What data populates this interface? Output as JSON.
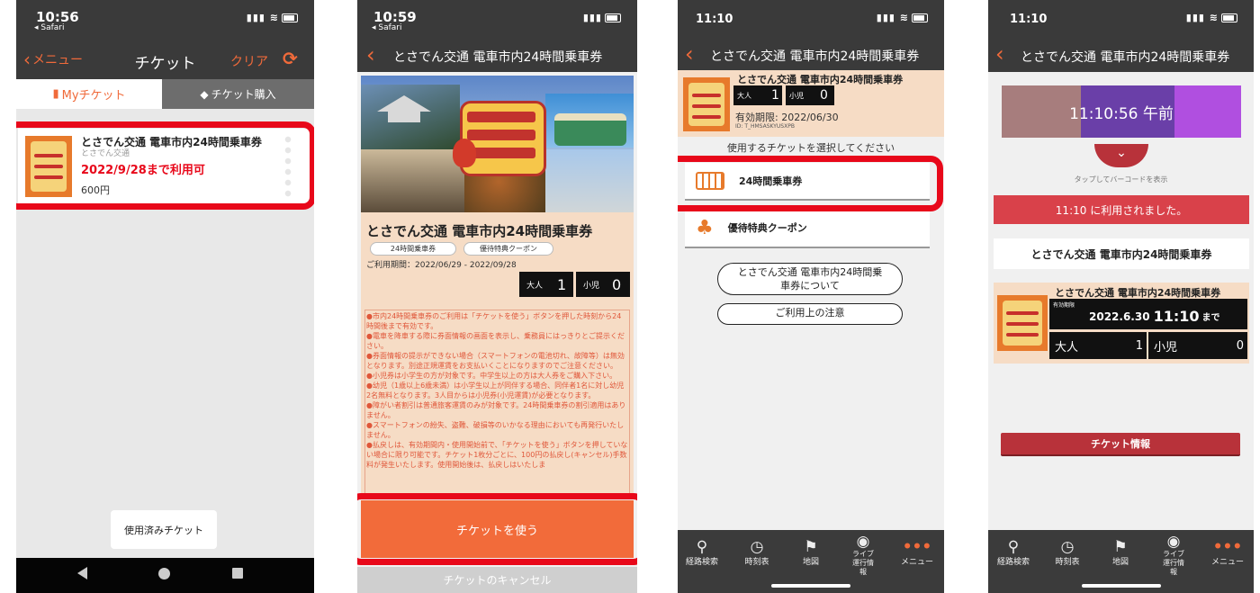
{
  "phone1": {
    "status_time": "10:56",
    "status_app": "◂ Safari",
    "nav": {
      "back_label": "メニュー",
      "title": "チケット",
      "clear_label": "クリア"
    },
    "tabs": {
      "my_tickets": "Myチケット",
      "buy": "チケット購入"
    },
    "ticket": {
      "name": "とさでん交通 電車市内24時間乗車券",
      "issuer": "とさでん交通",
      "valid_until": "2022/9/28まで利用可",
      "price": "600円"
    },
    "used_button": "使用済みチケット"
  },
  "phone2": {
    "status_time": "10:59",
    "status_app": "◂ Safari",
    "nav_title": "とさでん交通 電車市内24時間乗車券",
    "ticket_title": "とさでん交通 電車市内24時間乗車券",
    "tags": [
      "24時間乗車券",
      "優待特典クーポン"
    ],
    "period": "ご利用期間：2022/06/29 - 2022/09/28",
    "adult_label": "大人",
    "adult_count": "1",
    "child_label": "小児",
    "child_count": "0",
    "notes": [
      "●市内24時間乗車券のご利用は「チケットを使う」ボタンを押した時刻から24時間後まで有効です。",
      "●電車を降車する際に券面情報の画面を表示し、乗務員にはっきりとご提示ください。",
      "●券面情報の提示ができない場合（スマートフォンの電池切れ、故障等）は無効となります。別途正規運賃をお支払いくことになりますのでご注意ください。",
      "●小児券は小学生の方が対象です。中学生以上の方は大人券をご購入下さい。",
      "●幼児（1歳以上6歳未満）は小学生以上が同伴する場合、同伴者1名に対し幼児2名無料となります。3人目からは小児券(小児運賃)が必要となります。",
      "●障がい者割引は普通旅客運賃のみが対象です。24時間乗車券の割引適用はありません。",
      "●スマートフォンの紛失、盗難、破損等のいかなる理由においても再発行いたしません。",
      "●払戻しは、有効期間内・使用開始前で、「チケットを使う」ボタンを押していない場合に限り可能です。チケット1枚分ごとに、100円の払戻し(キャンセル)手数料が発生いたします。使用開始後は、払戻しはいたしま"
    ],
    "use_button": "チケットを使う",
    "cancel_button": "チケットのキャンセル"
  },
  "phone3": {
    "status_time": "11:10",
    "nav_title": "とさでん交通 電車市内24時間乗車券",
    "ticket_name": "とさでん交通 電車市内24時間乗車券",
    "adult_label": "大人",
    "adult_count": "1",
    "child_label": "小児",
    "child_count": "0",
    "expiry": "有効期限: 2022/06/30",
    "ticket_id": "ID: T_HMSASKYUSXPB",
    "select_prompt": "使用するチケットを選択してください",
    "options": [
      "24時間乗車券",
      "優待特典クーポン"
    ],
    "about_button": "とさでん交通 電車市内24時間乗車券について",
    "notes_button": "ご利用上の注意",
    "tabbar": [
      "経路検索",
      "時刻表",
      "地図",
      "ライブ運行情報",
      "メニュー"
    ]
  },
  "phone4": {
    "status_time": "11:10",
    "nav_title": "とさでん交通 電車市内24時間乗車券",
    "clock": "11:10:56 午前",
    "tap_hint": "タップしてバーコードを表示",
    "used_banner": "11:10 に利用されました。",
    "ticket_name_box": "とさでん交通 電車市内24時間乗車券",
    "ticket_name": "とさでん交通 電車市内24時間乗車券",
    "expiry_label": "有効期限",
    "expiry_date": "2022.6.30",
    "expiry_time": "11:10",
    "expiry_suffix": "まで",
    "adult_label": "大人",
    "adult_count": "1",
    "child_label": "小児",
    "child_count": "0",
    "info_button": "チケット情報",
    "tabbar": [
      "経路検索",
      "時刻表",
      "地図",
      "ライブ運行情報",
      "メニュー"
    ]
  },
  "colors": {
    "accent_orange": "#f26b3a",
    "highlight_red": "#e8081a",
    "dark_red": "#b8323a"
  }
}
